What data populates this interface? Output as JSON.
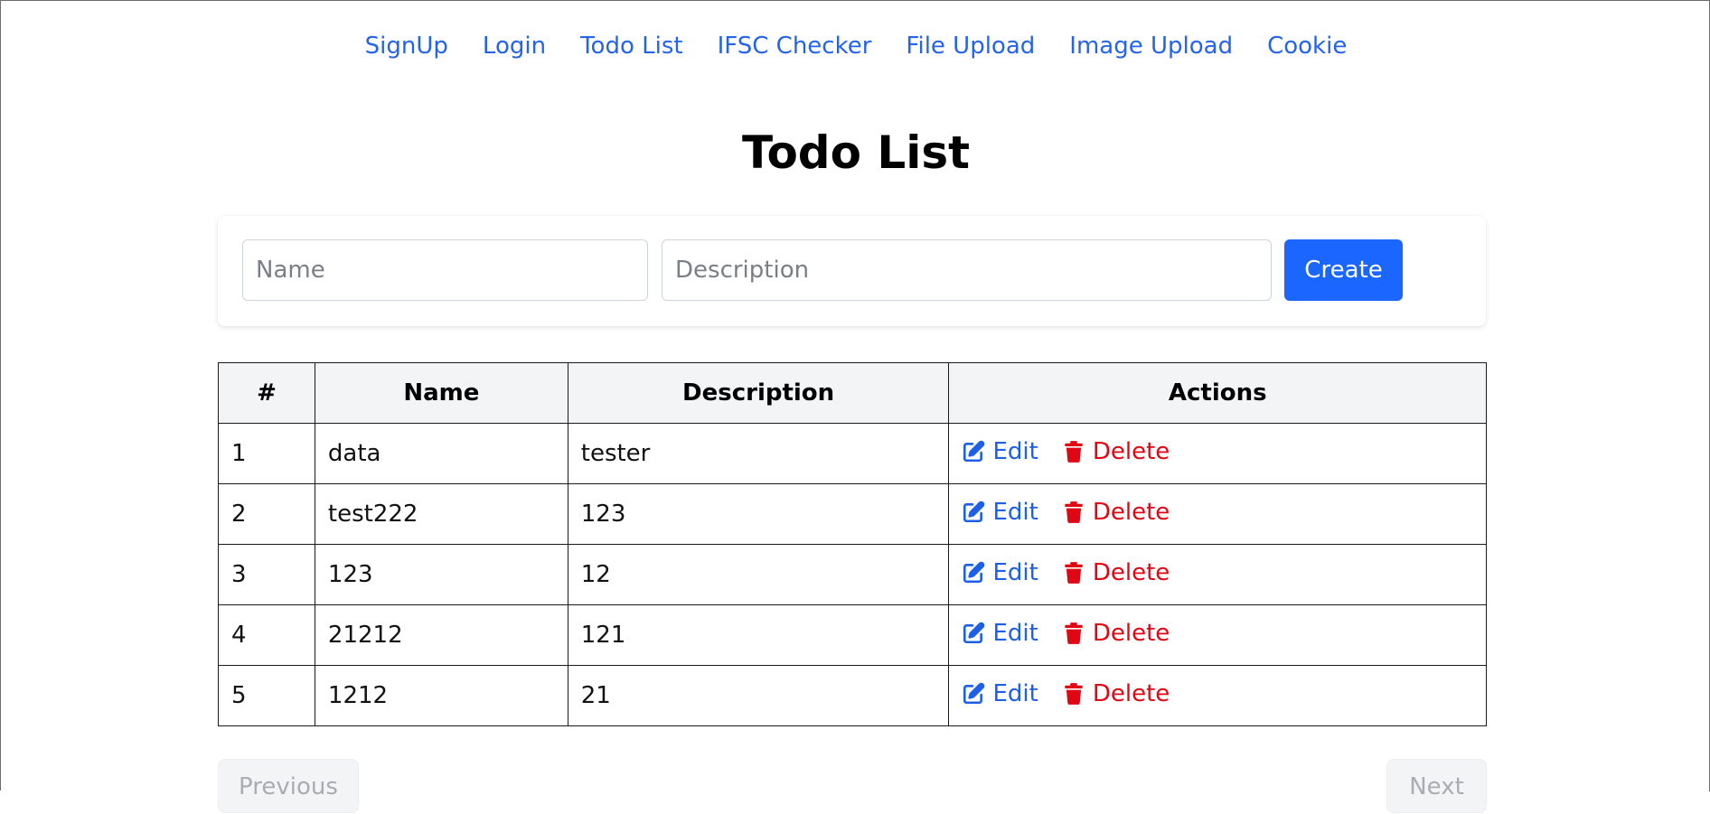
{
  "nav": {
    "items": [
      {
        "label": "SignUp"
      },
      {
        "label": "Login"
      },
      {
        "label": "Todo List"
      },
      {
        "label": "IFSC Checker"
      },
      {
        "label": "File Upload"
      },
      {
        "label": "Image Upload"
      },
      {
        "label": "Cookie"
      }
    ]
  },
  "page": {
    "title": "Todo List"
  },
  "form": {
    "name_placeholder": "Name",
    "name_value": "",
    "description_placeholder": "Description",
    "description_value": "",
    "create_label": "Create"
  },
  "table": {
    "headers": {
      "num": "#",
      "name": "Name",
      "description": "Description",
      "actions": "Actions"
    },
    "rows": [
      {
        "num": "1",
        "name": "data",
        "description": "tester",
        "edit": "Edit",
        "delete": "Delete"
      },
      {
        "num": "2",
        "name": "test222",
        "description": "123",
        "edit": "Edit",
        "delete": "Delete"
      },
      {
        "num": "3",
        "name": "123",
        "description": "12",
        "edit": "Edit",
        "delete": "Delete"
      },
      {
        "num": "4",
        "name": "21212",
        "description": "121",
        "edit": "Edit",
        "delete": "Delete"
      },
      {
        "num": "5",
        "name": "1212",
        "description": "21",
        "edit": "Edit",
        "delete": "Delete"
      }
    ]
  },
  "pagination": {
    "previous_label": "Previous",
    "next_label": "Next"
  },
  "icons": {
    "edit": "edit-icon",
    "delete": "trash-icon"
  },
  "colors": {
    "link": "#2563eb",
    "primary": "#1a66ff",
    "danger": "#e00613"
  }
}
